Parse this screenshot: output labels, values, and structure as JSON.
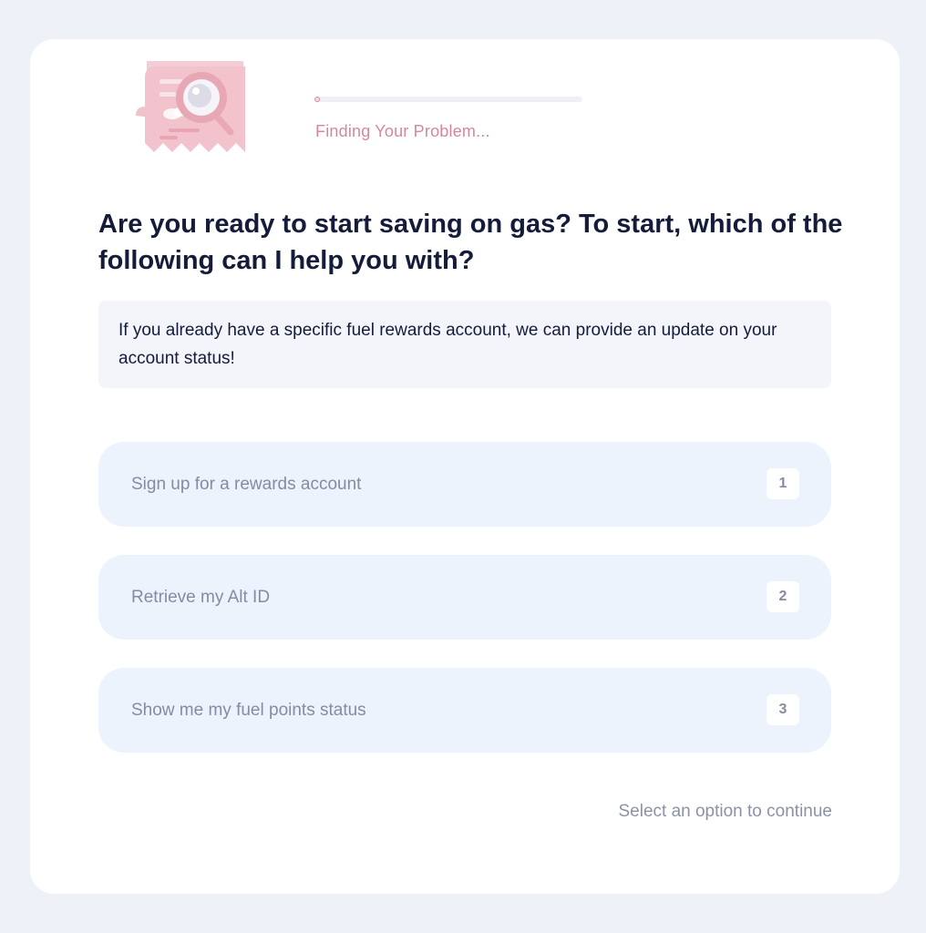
{
  "progress": {
    "label": "Finding Your Problem...",
    "percent": 2
  },
  "question": "Are you ready to start saving on gas? To start, which of the following can I help you with?",
  "info": "If you already have a specific fuel rewards account, we can provide an update on your account status!",
  "options": [
    {
      "label": "Sign up for a rewards account",
      "key": "1"
    },
    {
      "label": "Retrieve my Alt ID",
      "key": "2"
    },
    {
      "label": "Show me my fuel points status",
      "key": "3"
    }
  ],
  "footer_hint": "Select an option to continue",
  "illustration_icon": "receipt-magnifier-icon",
  "colors": {
    "page_bg": "#eef1f7",
    "accent_pink": "#d587a0",
    "heading": "#141c3a",
    "option_bg": "#edf3fd",
    "muted_text": "#858ba1"
  }
}
